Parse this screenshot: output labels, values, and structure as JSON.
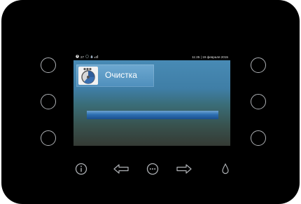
{
  "status_bar": {
    "icons": [
      "power-status-icon",
      "info-status-icon",
      "water-drop-status-icon",
      "signal-status-icon"
    ],
    "indicator_text": "27",
    "datetime": "11:25 | 19 февраля 2015"
  },
  "mode": {
    "title": "Очистка",
    "icon": "cleaning-cycle-icon"
  },
  "progress": {
    "fraction": 1.0
  },
  "controls": {
    "side_buttons": [
      "left-button-top",
      "left-button-middle",
      "left-button-bottom",
      "right-button-top",
      "right-button-middle",
      "right-button-bottom"
    ],
    "bottom_buttons": [
      "info-icon",
      "arrow-left-icon",
      "menu-dots-icon",
      "arrow-right-icon",
      "water-drop-icon"
    ]
  },
  "colors": {
    "panel": "#000000",
    "button_outline": "#aeb1b5",
    "progress_fill": "#2d6fb3",
    "screen_top": "#4a8db8"
  }
}
